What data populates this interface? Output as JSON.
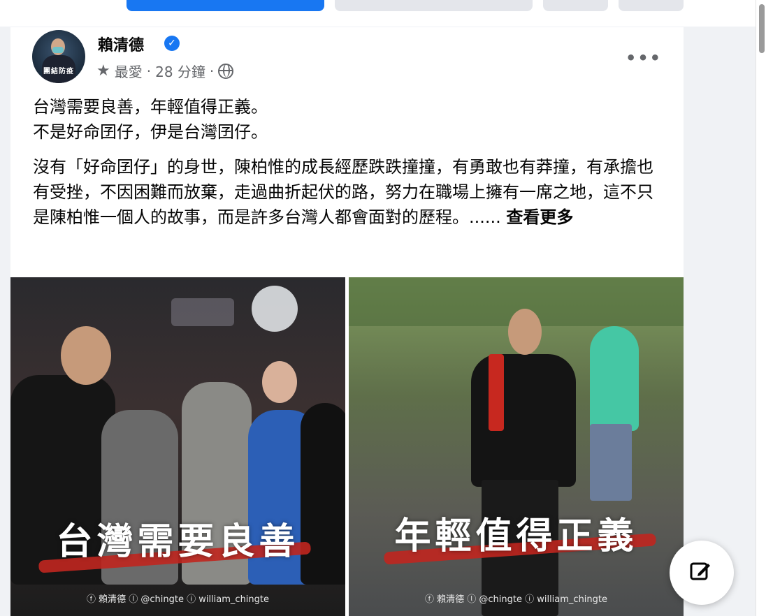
{
  "tabs": [
    {
      "name": "tab-1",
      "active": true
    },
    {
      "name": "tab-2",
      "active": false
    },
    {
      "name": "tab-3",
      "active": false
    },
    {
      "name": "tab-4",
      "active": false
    }
  ],
  "post": {
    "avatar_label": "團結防疫",
    "author": "賴清德",
    "verified_icon": "check-badge-icon",
    "meta_favorite": "最愛",
    "meta_sep1": "·",
    "meta_time": "28 分鐘",
    "meta_sep2": "·",
    "privacy_icon": "globe-icon",
    "more_label": "•••",
    "lines": [
      "台灣需要良善，年輕值得正義。",
      "不是好命囝仔，伊是台灣囝仔。"
    ],
    "body": "沒有「好命囝仔」的身世，陳柏惟的成長經歷跌跌撞撞，有勇敢也有莽撞，有承擔也有受挫，不因困難而放棄，走過曲折起伏的路，努力在職場上擁有一席之地，這不只是陳柏惟一個人的故事，而是許多台灣人都會面對的歷程。......",
    "see_more": "查看更多"
  },
  "photos": {
    "left_caption": "台灣需要良善",
    "right_caption": "年輕值得正義",
    "credits": "ⓕ 賴清德  ⓛ @chingte  ⓘ william_chingte"
  },
  "compose_icon": "edit-icon"
}
